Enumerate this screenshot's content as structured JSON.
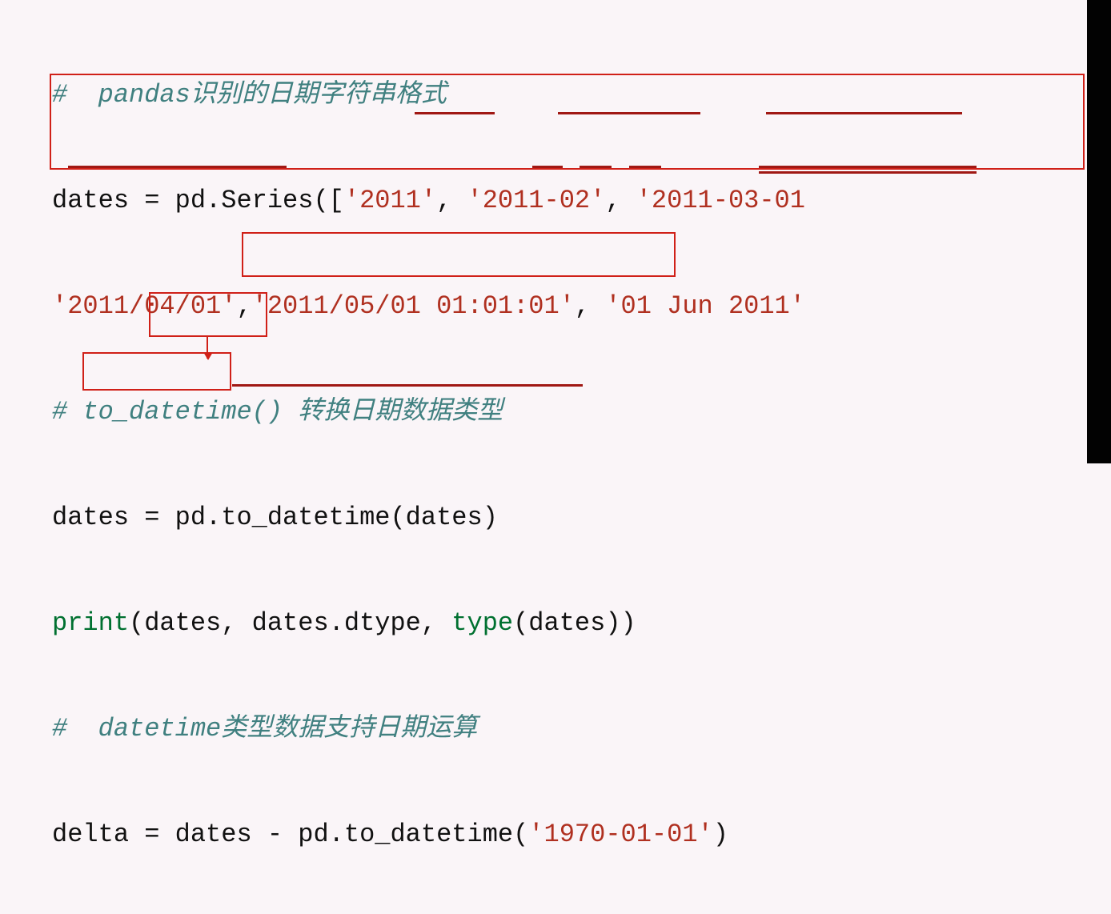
{
  "line1": {
    "prefix": "#  ",
    "text": "pandas识别的日期字符串格式"
  },
  "line2": {
    "lhs": "dates ",
    "eq": "= ",
    "obj": "pd",
    "dot": ".",
    "method": "Series",
    "open": "([",
    "s1": "'2011'",
    "c1": ", ",
    "s2": "'2011-02'",
    "c2": ", ",
    "s3": "'2011-03-01"
  },
  "line3": {
    "s1": "'2011/04/01'",
    "c1": ",",
    "s2": "'2011/05/01 01:01:01'",
    "c2": ", ",
    "s3": "'01 Jun 2011'"
  },
  "line4": {
    "prefix": "# ",
    "text": "to_datetime() 转换日期数据类型"
  },
  "line5": {
    "lhs": "dates ",
    "eq": "= ",
    "obj": "pd",
    "dot": ".",
    "method": "to_datetime",
    "open": "(",
    "arg": "dates",
    "close": ")"
  },
  "line6": {
    "func": "print",
    "open": "(",
    "a1": "dates",
    "c1": ", ",
    "a2": "dates",
    "dot": ".",
    "attr": "dtype",
    "c2": ", ",
    "typefn": "type",
    "open2": "(",
    "a3": "dates",
    "close": "))"
  },
  "line7": {
    "prefix": "#  ",
    "text": "datetime类型数据支持日期运算"
  },
  "line8": {
    "lhs": "delta ",
    "eq": "= ",
    "a1": "dates ",
    "op": "- ",
    "obj": "pd",
    "dot": ".",
    "method": "to_datetime",
    "open": "(",
    "arg": "'1970-01-01'",
    "close": ")"
  }
}
